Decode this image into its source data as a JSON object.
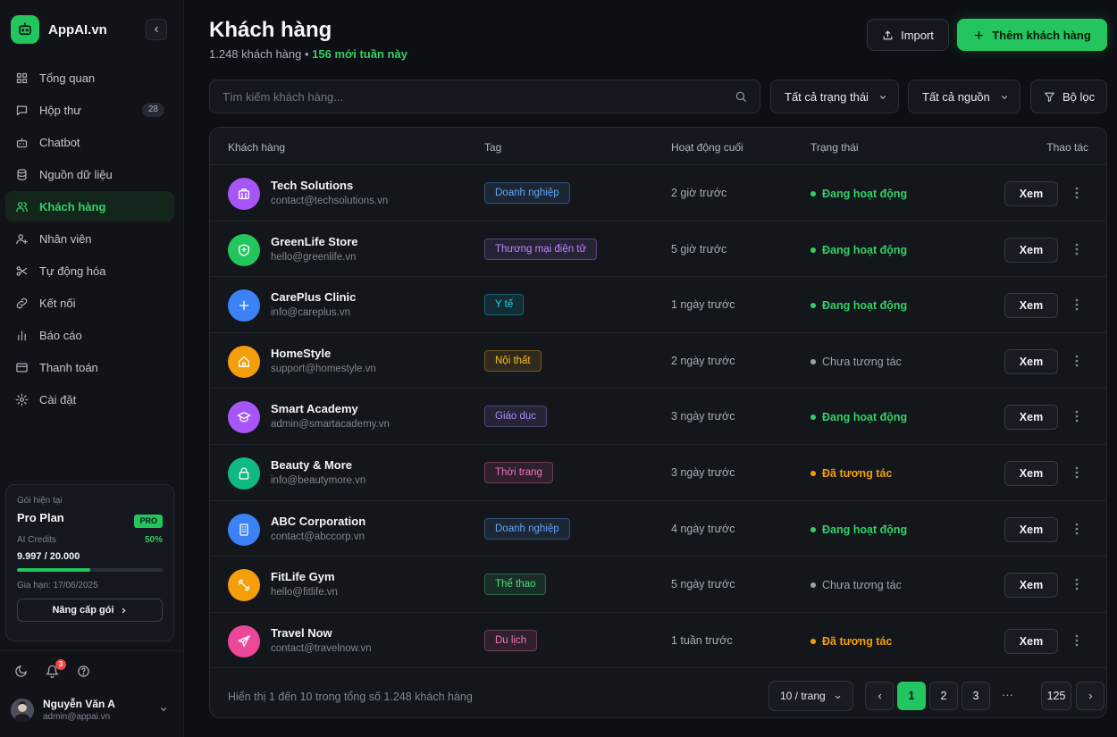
{
  "brand": {
    "name": "AppAI.vn",
    "accent": "#22c55e"
  },
  "sidebar": {
    "items": [
      {
        "label": "Tổng quan",
        "icon": "grid-icon"
      },
      {
        "label": "Hộp thư",
        "icon": "inbox-icon",
        "badge": "28"
      },
      {
        "label": "Chatbot",
        "icon": "bot-icon"
      },
      {
        "label": "Nguồn dữ liệu",
        "icon": "database-icon"
      },
      {
        "label": "Khách hàng",
        "icon": "users-icon",
        "active": true
      },
      {
        "label": "Nhân viên",
        "icon": "user-plus-icon"
      },
      {
        "label": "Tự động hóa",
        "icon": "scissors-icon"
      },
      {
        "label": "Kết nối",
        "icon": "link-icon"
      },
      {
        "label": "Báo cáo",
        "icon": "chart-icon"
      },
      {
        "label": "Thanh toán",
        "icon": "card-icon"
      },
      {
        "label": "Cài đặt",
        "icon": "gear-icon"
      }
    ],
    "plan": {
      "caption": "Gói hiện tại",
      "name": "Pro Plan",
      "badge": "PRO",
      "credits_label": "AI Credits",
      "credits_pct": "50%",
      "credits_fraction": 0.5,
      "credits_value": "9.997 / 20.000",
      "expiry": "Gia hạn: 17/06/2025",
      "upgrade_label": "Nâng cấp gói"
    },
    "notifications_count": "3",
    "user": {
      "name": "Nguyễn Văn A",
      "email": "admin@appai.vn"
    }
  },
  "header": {
    "title": "Khách hàng",
    "count_text": "1.248 khách hàng",
    "new_text": "156 mới tuần này",
    "import_label": "Import",
    "add_label": "Thêm khách hàng"
  },
  "toolbar": {
    "search_placeholder": "Tìm kiếm khách hàng...",
    "status_filter": "Tất cả trạng thái",
    "source_filter": "Tất cả nguồn",
    "filter_label": "Bộ lọc"
  },
  "table": {
    "columns": [
      "Khách hàng",
      "Tag",
      "Hoạt động cuối",
      "Trạng thái",
      "Thao tác"
    ],
    "view_label": "Xem",
    "rows": [
      {
        "name": "Tech Solutions",
        "email": "contact@techsolutions.vn",
        "tag": "Doanh nghiệp",
        "last": "2 giờ trước",
        "status": "Đang hoạt động",
        "icon": "building-icon",
        "avatar_color": "#a855f7",
        "tag_color": "#60a5fa",
        "status_color": "#34d067"
      },
      {
        "name": "GreenLife Store",
        "email": "hello@greenlife.vn",
        "tag": "Thương mại điện tử",
        "last": "5 giờ trước",
        "status": "Đang hoạt động",
        "icon": "shield-icon",
        "avatar_color": "#22c55e",
        "tag_color": "#c084fc",
        "status_color": "#34d067"
      },
      {
        "name": "CarePlus Clinic",
        "email": "info@careplus.vn",
        "tag": "Y tế",
        "last": "1 ngày trước",
        "status": "Đang hoạt động",
        "icon": "plus-icon",
        "avatar_color": "#3b82f6",
        "tag_color": "#22d3ee",
        "status_color": "#34d067"
      },
      {
        "name": "HomeStyle",
        "email": "support@homestyle.vn",
        "tag": "Nội thất",
        "last": "2 ngày trước",
        "status": "Chưa tương tác",
        "icon": "home-icon",
        "avatar_color": "#f59e0b",
        "tag_color": "#fbbf24",
        "status_color": "#9ca3af"
      },
      {
        "name": "Smart Academy",
        "email": "admin@smartacademy.vn",
        "tag": "Giáo dục",
        "last": "3 ngày trước",
        "status": "Đang hoạt động",
        "icon": "graduation-cap-icon",
        "avatar_color": "#a855f7",
        "tag_color": "#a78bfa",
        "status_color": "#34d067"
      },
      {
        "name": "Beauty & More",
        "email": "info@beautymore.vn",
        "tag": "Thời trang",
        "last": "3 ngày trước",
        "status": "Đã tương tác",
        "icon": "bag-icon",
        "avatar_color": "#10b981",
        "tag_color": "#f472b6",
        "status_color": "#f59e0b"
      },
      {
        "name": "ABC Corporation",
        "email": "contact@abccorp.vn",
        "tag": "Doanh nghiệp",
        "last": "4 ngày trước",
        "status": "Đang hoạt động",
        "icon": "office-icon",
        "avatar_color": "#3b82f6",
        "tag_color": "#60a5fa",
        "status_color": "#34d067"
      },
      {
        "name": "FitLife Gym",
        "email": "hello@fitlife.vn",
        "tag": "Thể thao",
        "last": "5 ngày trước",
        "status": "Chưa tương tác",
        "icon": "dumbbell-icon",
        "avatar_color": "#f59e0b",
        "tag_color": "#4ade80",
        "status_color": "#9ca3af"
      },
      {
        "name": "Travel Now",
        "email": "contact@travelnow.vn",
        "tag": "Du lịch",
        "last": "1 tuần trước",
        "status": "Đã tương tác",
        "icon": "plane-icon",
        "avatar_color": "#ec4899",
        "tag_color": "#f472b6",
        "status_color": "#f59e0b"
      }
    ]
  },
  "footer": {
    "summary": "Hiển thị 1 đến 10 trong tổng số 1.248 khách hàng",
    "per_page": "10 / trang",
    "pages": [
      "1",
      "2",
      "3"
    ],
    "ellipsis": "···",
    "last_page": "125",
    "current_page": "1"
  }
}
